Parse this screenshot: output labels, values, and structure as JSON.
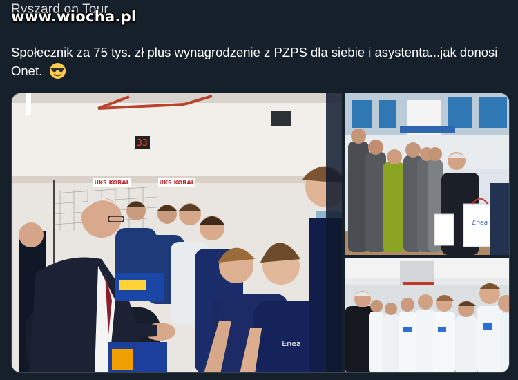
{
  "tweet": {
    "author": "Ryszard on Tour",
    "text": "Społecznik za 75 tys. zł plus wynagrodzenie z PZPS dla siebie i asystenta...jak donosi Onet.",
    "emoji": "smiling-face-with-sunglasses"
  },
  "watermark": "www.wiocha.pl",
  "photos": {
    "main": {
      "scoreboard": "33",
      "banners": [
        "UKS KORAL",
        "UKS KORAL"
      ],
      "jersey_text": "Enea"
    },
    "top_right": {
      "bag_text": "Enea"
    }
  },
  "colors": {
    "background": "#15202b",
    "jersey_navy": "#16234f",
    "divider": "#38444d"
  }
}
